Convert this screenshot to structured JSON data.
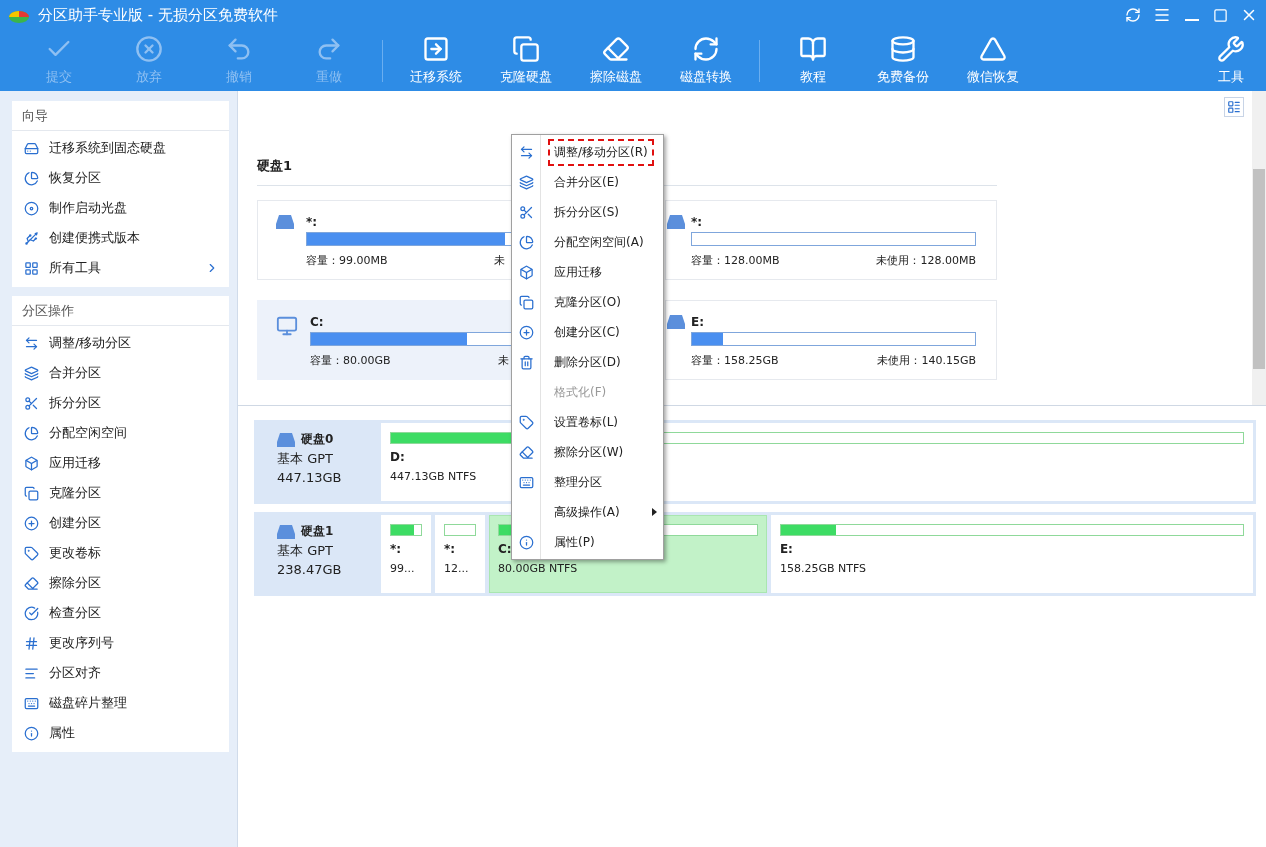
{
  "window": {
    "title": "分区助手专业版 - 无损分区免费软件"
  },
  "toolbar": {
    "groups": [
      [
        {
          "label": "提交",
          "disabled": true
        },
        {
          "label": "放弃",
          "disabled": true
        },
        {
          "label": "撤销",
          "disabled": true
        },
        {
          "label": "重做",
          "disabled": true
        }
      ],
      [
        {
          "label": "迁移系统",
          "disabled": false
        },
        {
          "label": "克隆硬盘",
          "disabled": false
        },
        {
          "label": "擦除磁盘",
          "disabled": false
        },
        {
          "label": "磁盘转换",
          "disabled": false
        }
      ],
      [
        {
          "label": "教程",
          "disabled": false
        },
        {
          "label": "免费备份",
          "disabled": false
        },
        {
          "label": "微信恢复",
          "disabled": false
        }
      ]
    ],
    "tools": {
      "label": "工具"
    }
  },
  "sidebar": {
    "sections": [
      {
        "title": "向导",
        "items": [
          {
            "label": "迁移系统到固态硬盘",
            "submenu": false
          },
          {
            "label": "恢复分区",
            "submenu": false
          },
          {
            "label": "制作启动光盘",
            "submenu": false
          },
          {
            "label": "创建便携式版本",
            "submenu": false
          },
          {
            "label": "所有工具",
            "submenu": true
          }
        ]
      },
      {
        "title": "分区操作",
        "items": [
          {
            "label": "调整/移动分区",
            "submenu": false
          },
          {
            "label": "合并分区",
            "submenu": false
          },
          {
            "label": "拆分分区",
            "submenu": false
          },
          {
            "label": "分配空闲空间",
            "submenu": false
          },
          {
            "label": "应用迁移",
            "submenu": false
          },
          {
            "label": "克隆分区",
            "submenu": false
          },
          {
            "label": "创建分区",
            "submenu": false
          },
          {
            "label": "更改卷标",
            "submenu": false
          },
          {
            "label": "擦除分区",
            "submenu": false
          },
          {
            "label": "检查分区",
            "submenu": false
          },
          {
            "label": "更改序列号",
            "submenu": false
          },
          {
            "label": "分区对齐",
            "submenu": false
          },
          {
            "label": "磁盘碎片整理",
            "submenu": false
          },
          {
            "label": "属性",
            "submenu": false
          }
        ]
      }
    ]
  },
  "disk_view": {
    "title": "硬盘1",
    "cards": [
      {
        "name": "*:",
        "kind": "drive",
        "level": 0.7,
        "capacity": "容量：99.00MB",
        "free": "未",
        "selected": false
      },
      {
        "name": "*:",
        "kind": "drive",
        "level": 0,
        "capacity": "容量：128.00MB",
        "free": "未使用：128.00MB",
        "selected": false
      },
      {
        "name": "C:",
        "kind": "windows",
        "level": 0.55,
        "capacity": "容量：80.00GB",
        "free": "未",
        "selected": true
      },
      {
        "name": "E:",
        "kind": "drive",
        "level": 0.11,
        "capacity": "容量：158.25GB",
        "free": "未使用：140.15GB",
        "selected": false
      }
    ]
  },
  "disk_map": [
    {
      "name": "硬盘0",
      "type": "基本 GPT",
      "size": "447.13GB",
      "partitions": [
        {
          "label": "D:",
          "info": "447.13GB NTFS",
          "level": 0.17,
          "kind": "large",
          "selected": false
        }
      ]
    },
    {
      "name": "硬盘1",
      "type": "基本 GPT",
      "size": "238.47GB",
      "partitions": [
        {
          "label": "*:",
          "info": "99...",
          "level": 0.75,
          "kind": "small",
          "selected": false
        },
        {
          "label": "*:",
          "info": "12...",
          "level": 0,
          "kind": "small",
          "selected": false
        },
        {
          "label": "C:",
          "info": "80.00GB NTFS",
          "level": 0.6,
          "kind": "medium",
          "selected": true
        },
        {
          "label": "E:",
          "info": "158.25GB NTFS",
          "level": 0.12,
          "kind": "large",
          "selected": false
        }
      ]
    }
  ],
  "context_menu": [
    {
      "label": "调整/移动分区(R)",
      "disabled": false,
      "highlighted": true,
      "submenu": false
    },
    {
      "label": "合并分区(E)",
      "disabled": false,
      "highlighted": false,
      "submenu": false
    },
    {
      "label": "拆分分区(S)",
      "disabled": false,
      "highlighted": false,
      "submenu": false
    },
    {
      "label": "分配空闲空间(A)",
      "disabled": false,
      "highlighted": false,
      "submenu": false
    },
    {
      "label": "应用迁移",
      "disabled": false,
      "highlighted": false,
      "submenu": false
    },
    {
      "label": "克隆分区(O)",
      "disabled": false,
      "highlighted": false,
      "submenu": false
    },
    {
      "label": "创建分区(C)",
      "disabled": false,
      "highlighted": false,
      "submenu": false
    },
    {
      "label": "删除分区(D)",
      "disabled": false,
      "highlighted": false,
      "submenu": false
    },
    {
      "label": "格式化(F)",
      "disabled": true,
      "highlighted": false,
      "submenu": false
    },
    {
      "label": "设置卷标(L)",
      "disabled": false,
      "highlighted": false,
      "submenu": false
    },
    {
      "label": "擦除分区(W)",
      "disabled": false,
      "highlighted": false,
      "submenu": false
    },
    {
      "label": "整理分区",
      "disabled": false,
      "highlighted": false,
      "submenu": false
    },
    {
      "label": "高级操作(A)",
      "disabled": false,
      "highlighted": false,
      "submenu": true
    },
    {
      "label": "属性(P)",
      "disabled": false,
      "highlighted": false,
      "submenu": false
    }
  ]
}
